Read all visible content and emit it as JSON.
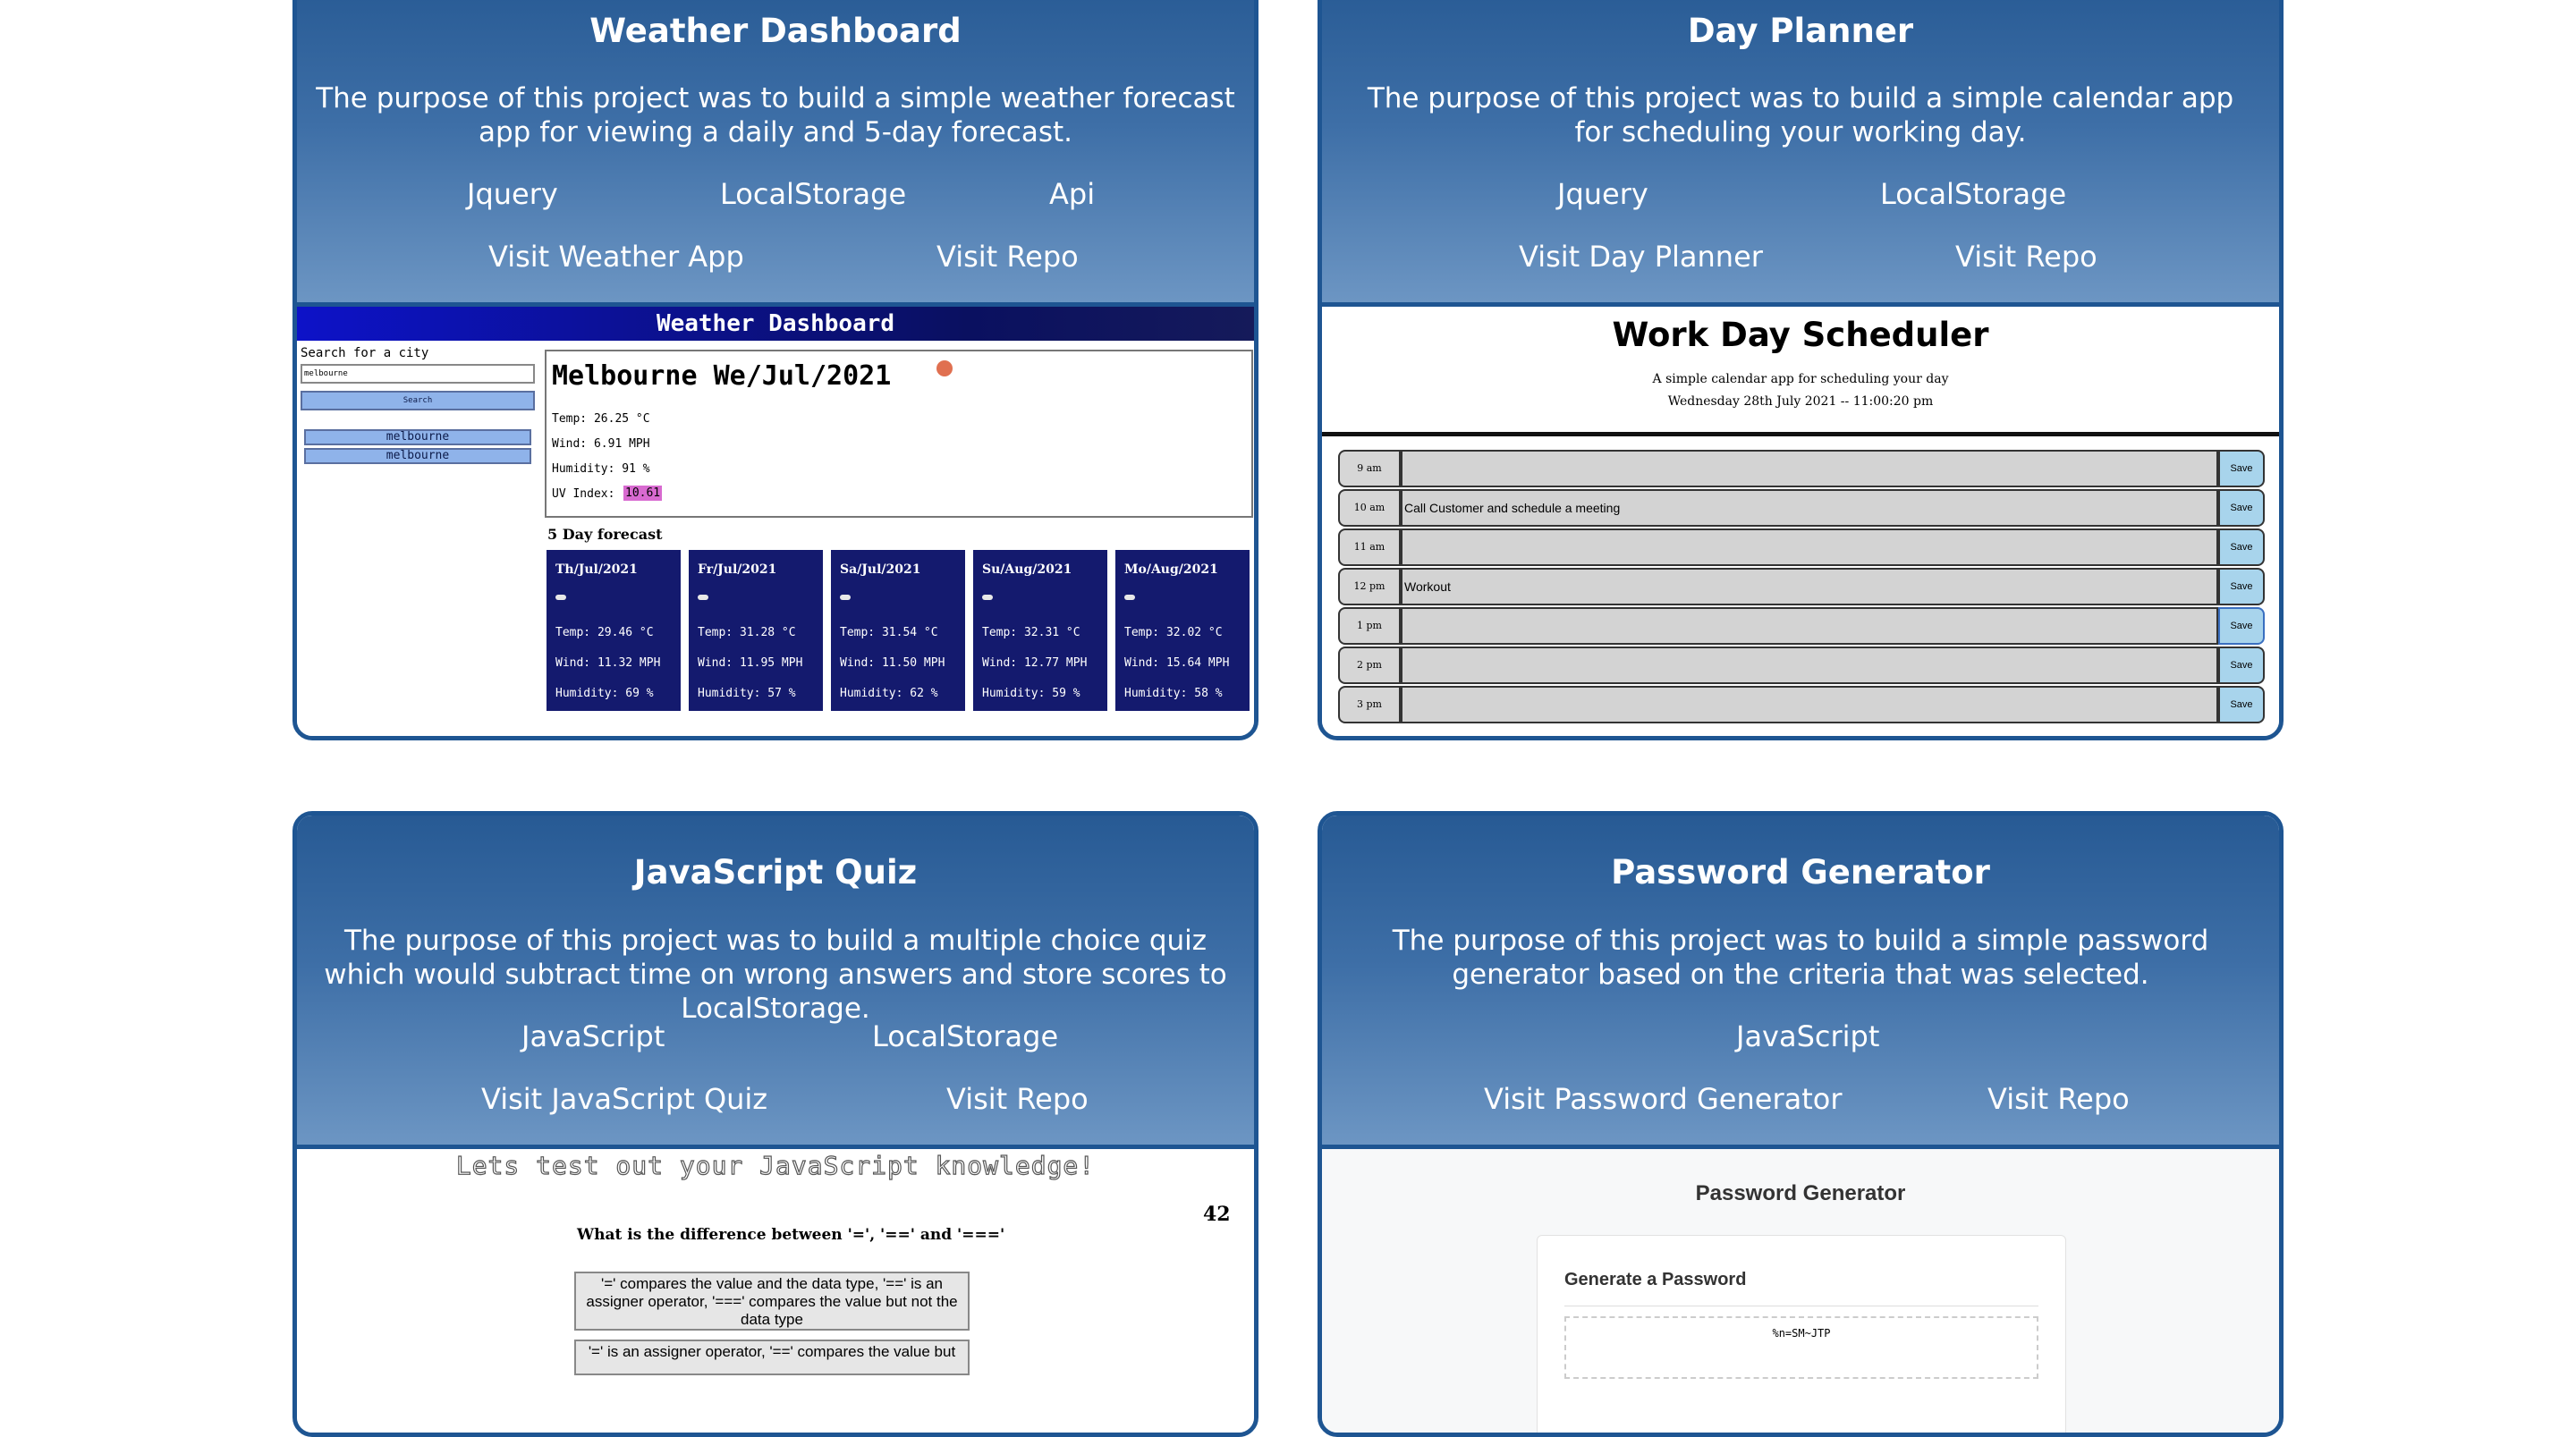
{
  "projects": [
    {
      "title": "Weather Dashboard",
      "description": "The purpose of this project was to build a simple weather forecast app for viewing a daily and 5-day forecast.",
      "tech": [
        "Jquery",
        "LocalStorage",
        "Api"
      ],
      "links": [
        "Visit Weather App",
        "Visit Repo"
      ]
    },
    {
      "title": "Day Planner",
      "description": "The purpose of this project was to build a simple calendar app for scheduling your working day.",
      "tech": [
        "Jquery",
        "LocalStorage"
      ],
      "links": [
        "Visit Day Planner",
        "Visit Repo"
      ]
    },
    {
      "title": "JavaScript Quiz",
      "description": "The purpose of this project was to build a multiple choice quiz which would subtract time on wrong answers and store scores to LocalStorage.",
      "tech": [
        "JavaScript",
        "LocalStorage"
      ],
      "links": [
        "Visit JavaScript Quiz",
        "Visit Repo"
      ]
    },
    {
      "title": "Password Generator",
      "description": "The purpose of this project was to build a simple password generator based on the criteria that was selected.",
      "tech": [
        "JavaScript"
      ],
      "links": [
        "Visit Password Generator",
        "Visit Repo"
      ]
    }
  ],
  "weather": {
    "header": "Weather Dashboard",
    "search_label": "Search for a city",
    "search_value": "melbourne",
    "search_button": "Search",
    "history": [
      "melbourne",
      "melbourne"
    ],
    "city_date": "Melbourne We/Jul/2021",
    "temp": "Temp: 26.25 °C",
    "wind": "Wind: 6.91 MPH",
    "humidity": "Humidity: 91 %",
    "uv_label": "UV Index:",
    "uv_value": "10.61",
    "forecast_title": "5 Day forecast",
    "forecast": [
      {
        "date": "Th/Jul/2021",
        "temp": "Temp: 29.46 °C",
        "wind": "Wind: 11.32 MPH",
        "humidity": "Humidity: 69 %"
      },
      {
        "date": "Fr/Jul/2021",
        "temp": "Temp: 31.28 °C",
        "wind": "Wind: 11.95 MPH",
        "humidity": "Humidity: 57 %"
      },
      {
        "date": "Sa/Jul/2021",
        "temp": "Temp: 31.54 °C",
        "wind": "Wind: 11.50 MPH",
        "humidity": "Humidity: 62 %"
      },
      {
        "date": "Su/Aug/2021",
        "temp": "Temp: 32.31 °C",
        "wind": "Wind: 12.77 MPH",
        "humidity": "Humidity: 59 %"
      },
      {
        "date": "Mo/Aug/2021",
        "temp": "Temp: 32.02 °C",
        "wind": "Wind: 15.64 MPH",
        "humidity": "Humidity: 58 %"
      }
    ]
  },
  "planner": {
    "title": "Work Day Scheduler",
    "subtitle": "A simple calendar app for scheduling your day",
    "date": "Wednesday 28th July 2021 -- 11:00:20 pm",
    "save_label": "Save",
    "rows": [
      {
        "time": "9 am",
        "text": ""
      },
      {
        "time": "10 am",
        "text": "Call Customer and schedule a meeting"
      },
      {
        "time": "11 am",
        "text": ""
      },
      {
        "time": "12 pm",
        "text": "Workout"
      },
      {
        "time": "1 pm",
        "text": ""
      },
      {
        "time": "2 pm",
        "text": ""
      },
      {
        "time": "3 pm",
        "text": ""
      }
    ]
  },
  "quiz": {
    "heading": "Lets test out your JavaScript knowledge!",
    "timer": "42",
    "question": "What is the difference between '=', '==' and '==='",
    "options": [
      "'=' compares the value and the data type, '==' is an assigner operator, '===' compares the value but not the data type",
      "'=' is an assigner operator, '==' compares the value but"
    ]
  },
  "password": {
    "title": "Password Generator",
    "card_title": "Generate a Password",
    "value": "%n=SM~JTP"
  }
}
